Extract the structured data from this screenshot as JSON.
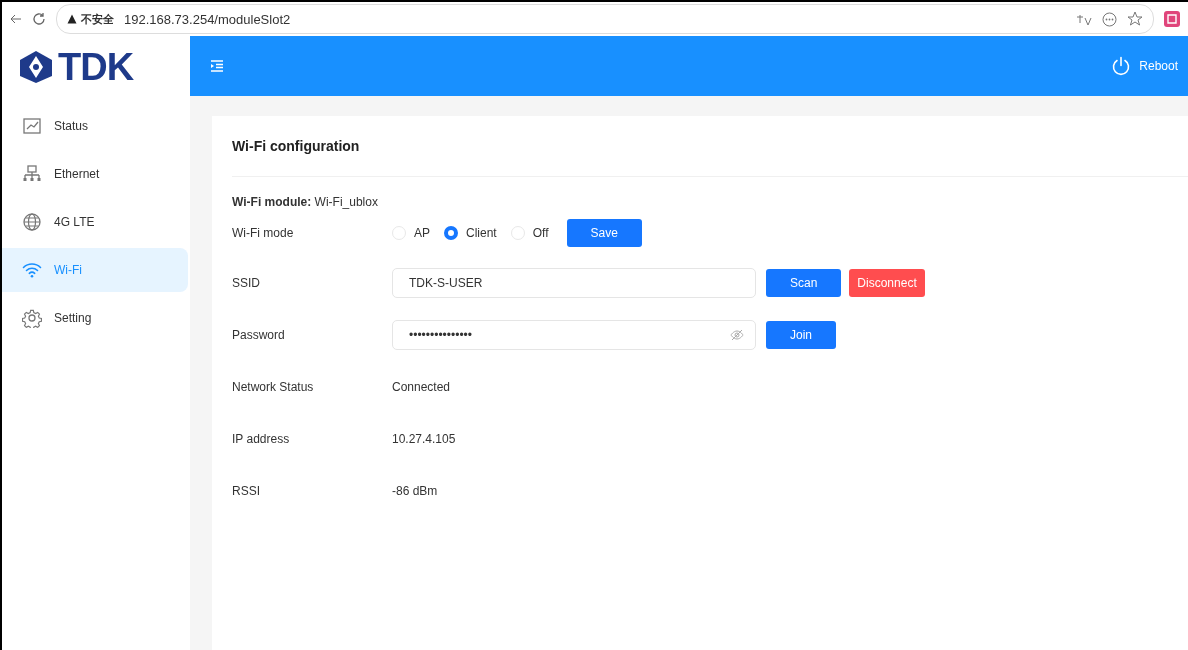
{
  "browser": {
    "security": "不安全",
    "url": "192.168.73.254/moduleSlot2"
  },
  "header": {
    "logo": "TDK",
    "reboot": "Reboot"
  },
  "sidebar": {
    "items": [
      {
        "label": "Status",
        "kind": "chart",
        "selected": false
      },
      {
        "label": "Ethernet",
        "kind": "network",
        "selected": false
      },
      {
        "label": "4G LTE",
        "kind": "globe",
        "selected": false
      },
      {
        "label": "Wi-Fi",
        "kind": "wifi",
        "selected": true
      },
      {
        "label": "Setting",
        "kind": "gear",
        "selected": false
      }
    ]
  },
  "card": {
    "title": "Wi-Fi configuration",
    "module_label": "Wi-Fi module:",
    "module_value": "Wi-Fi_ublox",
    "mode": {
      "label": "Wi-Fi mode",
      "options": [
        {
          "label": "AP",
          "selected": false
        },
        {
          "label": "Client",
          "selected": true
        },
        {
          "label": "Off",
          "selected": false
        }
      ],
      "button": "Save"
    },
    "ssid": {
      "label": "SSID",
      "value": "TDK-S-USER",
      "buttons": [
        {
          "label": "Scan",
          "kind": "primary"
        },
        {
          "label": "Disconnect",
          "kind": "danger"
        }
      ]
    },
    "password": {
      "label": "Password",
      "value": "•••••••••••••••",
      "button": "Join"
    },
    "info": [
      {
        "label": "Network Status",
        "value": "Connected"
      },
      {
        "label": "IP address",
        "value": "10.27.4.105"
      },
      {
        "label": "RSSI",
        "value": "-86 dBm"
      }
    ]
  }
}
